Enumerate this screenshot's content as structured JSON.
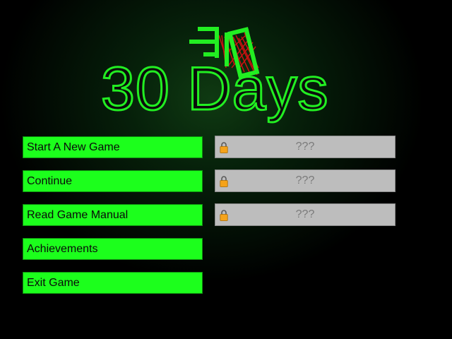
{
  "game": {
    "title": "30 Days"
  },
  "menu": {
    "items": [
      {
        "label": "Start A New Game"
      },
      {
        "label": "Continue"
      },
      {
        "label": "Read Game Manual"
      },
      {
        "label": "Achievements"
      },
      {
        "label": "Exit Game"
      }
    ]
  },
  "slots": [
    {
      "label": "???",
      "locked": true,
      "icon": "padlock-icon"
    },
    {
      "label": "???",
      "locked": true,
      "icon": "padlock-icon"
    },
    {
      "label": "???",
      "locked": true,
      "icon": "padlock-icon"
    }
  ],
  "colors": {
    "accent_green": "#1cff1c",
    "locked_gray": "#bdbdbd",
    "lock_orange": "#f5a31a",
    "art_red": "#cc1111"
  }
}
